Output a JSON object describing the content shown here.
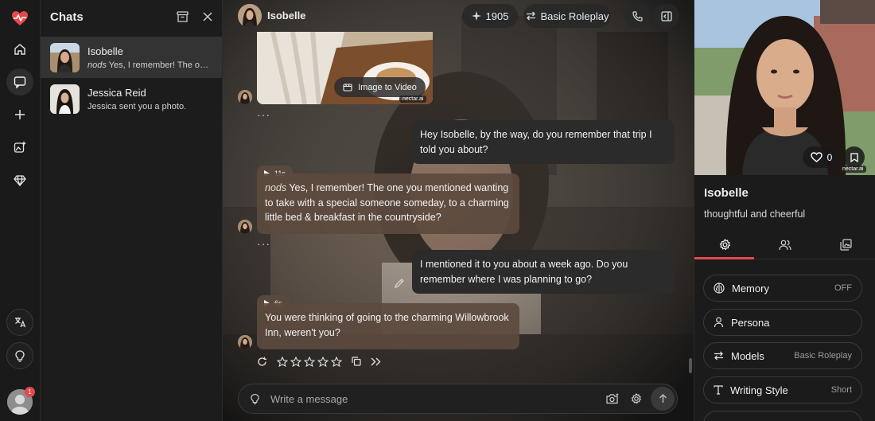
{
  "app": {
    "name": "nectar.ai"
  },
  "chats_panel": {
    "title": "Chats",
    "items": [
      {
        "name": "Isobelle",
        "preview_action": "nods",
        "preview": "Yes, I remember! The one you mentioned wanting to take with a special someone",
        "selected": true
      },
      {
        "name": "Jessica Reid",
        "preview_action": "",
        "preview": "Jessica sent you a photo.",
        "selected": false
      }
    ]
  },
  "rail": {
    "notification_count": "1"
  },
  "chat": {
    "character_name": "Isobelle",
    "stars_count": "1905",
    "mode_label": "Basic Roleplay",
    "image_action_label": "Image to Video",
    "watermark": "nectar.ai",
    "messages": [
      {
        "role": "user",
        "text": "Hey Isobelle, by the way, do you remember that trip I told you about?"
      },
      {
        "role": "bot",
        "duration": "11s",
        "action": "nods",
        "text": "Yes, I remember! The one you mentioned wanting to take with a special someone someday, to a charming little bed & breakfast in the countryside?"
      },
      {
        "role": "user",
        "text": "I mentioned it to you about a week ago. Do you remember where I was planning to go?"
      },
      {
        "role": "bot",
        "duration": "6s",
        "action": "",
        "text": "You were thinking of going to the charming Willowbrook Inn, weren't you?"
      }
    ],
    "rating_max": 5,
    "input_placeholder": "Write a message",
    "dots": "···"
  },
  "profile": {
    "name": "Isobelle",
    "tagline": "thoughtful and cheerful",
    "likes": "0",
    "watermark": "nectar.ai",
    "options": [
      {
        "label": "Memory",
        "value": "OFF",
        "icon": "brain-icon"
      },
      {
        "label": "Persona",
        "value": "",
        "icon": "user-icon"
      },
      {
        "label": "Models",
        "value": "Basic Roleplay",
        "icon": "swap-icon"
      },
      {
        "label": "Writing Style",
        "value": "Short",
        "icon": "text-icon"
      }
    ]
  },
  "colors": {
    "accent": "#e5484d",
    "bot_bubble": "#5c4a3e",
    "user_bubble": "#2b2b2b"
  }
}
